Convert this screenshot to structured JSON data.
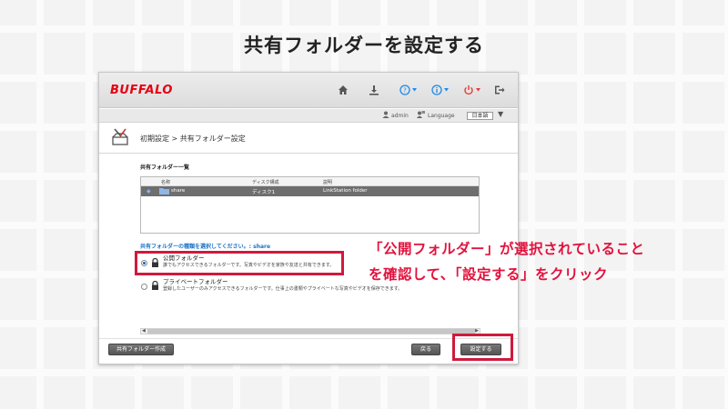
{
  "page": {
    "title": "共有フォルダーを設定する",
    "callout_line1": "「公開フォルダー」が選択されていること",
    "callout_line2": "を確認して、「設定する」をクリック",
    "accent_color": "#e2123d"
  },
  "app": {
    "brand": "BUFFALO",
    "brand_color": "#e60012",
    "toolbar_icons": [
      "home-icon",
      "download-icon",
      "help-icon",
      "info-icon",
      "power-icon",
      "logout-icon"
    ]
  },
  "userbar": {
    "user": "admin",
    "language_label": "Language",
    "language_value": "日本語"
  },
  "breadcrumb": "初期設定 > 共有フォルダー設定",
  "share_list": {
    "title": "共有フォルダー一覧",
    "columns": [
      "名称",
      "ディスク構成",
      "説明"
    ],
    "rows": [
      {
        "name": "share",
        "disk": "ディスク1",
        "description": "LinkStation folder"
      }
    ]
  },
  "folder_type": {
    "prompt": "共有フォルダーの種類を選択してください。: share",
    "options": [
      {
        "title": "公開フォルダー",
        "description": "誰でもアクセスできるフォルダーです。写真やビデオを家族や友達と共有できます。",
        "selected": true
      },
      {
        "title": "プライベートフォルダー",
        "description": "登録したユーザーのみアクセスできるフォルダーです。仕事上の書類やプライベートな写真やビデオを保存できます。",
        "selected": false
      }
    ]
  },
  "buttons": {
    "create": "共有フォルダー作成",
    "back": "戻る",
    "apply": "設定する"
  }
}
